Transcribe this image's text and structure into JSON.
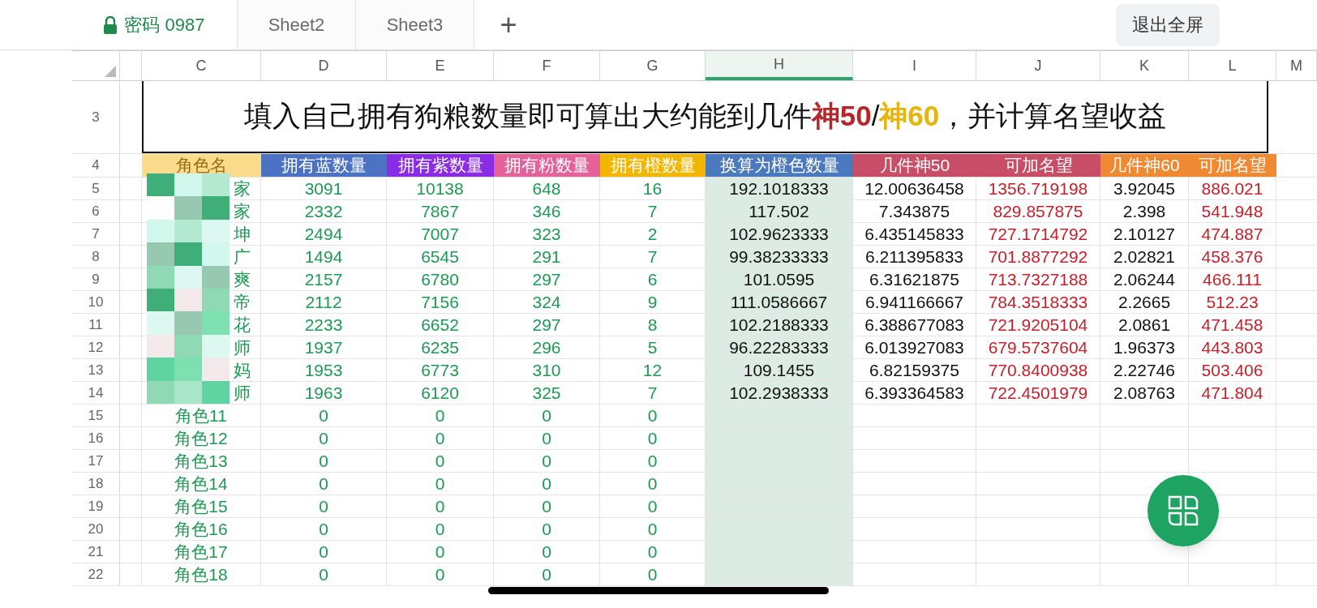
{
  "sheet_tabs": [
    {
      "label": "密码 0987",
      "locked": true,
      "selected": true
    },
    {
      "label": "Sheet2",
      "locked": false,
      "selected": false
    },
    {
      "label": "Sheet3",
      "locked": false,
      "selected": false
    }
  ],
  "add_sheet": "+",
  "exit_button": "退出全屏",
  "column_letters": [
    {
      "letter": "C",
      "selected": false
    },
    {
      "letter": "D",
      "selected": false
    },
    {
      "letter": "E",
      "selected": false
    },
    {
      "letter": "F",
      "selected": false
    },
    {
      "letter": "G",
      "selected": false
    },
    {
      "letter": "H",
      "selected": true
    },
    {
      "letter": "I",
      "selected": false
    },
    {
      "letter": "J",
      "selected": false
    },
    {
      "letter": "K",
      "selected": false
    },
    {
      "letter": "L",
      "selected": false
    },
    {
      "letter": "M",
      "selected": false
    }
  ],
  "title_row": {
    "number": "3",
    "parts": [
      {
        "text": "填入自己拥有狗粮数量即可算出大约能到几件"
      },
      {
        "text": "神50",
        "color": "#b8262c"
      },
      {
        "text": "/"
      },
      {
        "text": "神60",
        "color": "#e6b40a"
      },
      {
        "text": "，并计算名望收益"
      }
    ]
  },
  "header_row": {
    "number": "4",
    "headers": [
      {
        "text": "角色名",
        "color": "#fbdc8c",
        "kind": "name"
      },
      {
        "text": "拥有蓝数量",
        "color": "#4c72c4",
        "kind": "count"
      },
      {
        "text": "拥有紫数量",
        "color": "#8a2be6",
        "kind": "count"
      },
      {
        "text": "拥有粉数量",
        "color": "#e4619a",
        "kind": "count"
      },
      {
        "text": "拥有橙数量",
        "color": "#f3b600",
        "kind": "count"
      },
      {
        "text": "换算为橙色数量",
        "color": "#4b79bd",
        "kind": "plain"
      },
      {
        "text": "几件神50",
        "color": "#c84d67",
        "kind": "plain"
      },
      {
        "text": "可加名望",
        "color": "#c84d67",
        "kind": "fame"
      },
      {
        "text": "几件神60",
        "color": "#ef8a33",
        "kind": "plain"
      },
      {
        "text": "可加名望",
        "color": "#ef8a33",
        "kind": "fame"
      }
    ]
  },
  "rows": [
    {
      "number": "5",
      "cells": [
        "家",
        "3091",
        "10138",
        "648",
        "16",
        "192.1018333",
        "12.00636458",
        "1356.719198",
        "3.92045",
        "886.021"
      ]
    },
    {
      "number": "6",
      "cells": [
        "家",
        "2332",
        "7867",
        "346",
        "7",
        "117.502",
        "7.343875",
        "829.857875",
        "2.398",
        "541.948"
      ]
    },
    {
      "number": "7",
      "cells": [
        "坤",
        "2494",
        "7007",
        "323",
        "2",
        "102.9623333",
        "6.435145833",
        "727.1714792",
        "2.10127",
        "474.887"
      ]
    },
    {
      "number": "8",
      "cells": [
        "广",
        "1494",
        "6545",
        "291",
        "7",
        "99.38233333",
        "6.211395833",
        "701.8877292",
        "2.02821",
        "458.376"
      ]
    },
    {
      "number": "9",
      "cells": [
        "爽",
        "2157",
        "6780",
        "297",
        "6",
        "101.0595",
        "6.31621875",
        "713.7327188",
        "2.06244",
        "466.111"
      ]
    },
    {
      "number": "10",
      "cells": [
        "帝",
        "2112",
        "7156",
        "324",
        "9",
        "111.0586667",
        "6.941166667",
        "784.3518333",
        "2.2665",
        "512.23"
      ]
    },
    {
      "number": "11",
      "cells": [
        "花",
        "2233",
        "6652",
        "297",
        "8",
        "102.2188333",
        "6.388677083",
        "721.9205104",
        "2.0861",
        "471.458"
      ]
    },
    {
      "number": "12",
      "cells": [
        "师",
        "1937",
        "6235",
        "296",
        "5",
        "96.22283333",
        "6.013927083",
        "679.5737604",
        "1.96373",
        "443.803"
      ]
    },
    {
      "number": "13",
      "cells": [
        "妈",
        "1953",
        "6773",
        "310",
        "12",
        "109.1455",
        "6.82159375",
        "770.8400938",
        "2.22746",
        "503.406"
      ]
    },
    {
      "number": "14",
      "cells": [
        "师",
        "1963",
        "6120",
        "325",
        "7",
        "102.2938333",
        "6.393364583",
        "722.4501979",
        "2.08763",
        "471.804"
      ]
    },
    {
      "number": "15",
      "cells": [
        "角色11",
        "0",
        "0",
        "0",
        "0"
      ]
    },
    {
      "number": "16",
      "cells": [
        "角色12",
        "0",
        "0",
        "0",
        "0"
      ]
    },
    {
      "number": "17",
      "cells": [
        "角色13",
        "0",
        "0",
        "0",
        "0"
      ]
    },
    {
      "number": "18",
      "cells": [
        "角色14",
        "0",
        "0",
        "0",
        "0"
      ]
    },
    {
      "number": "19",
      "cells": [
        "角色15",
        "0",
        "0",
        "0",
        "0"
      ]
    },
    {
      "number": "20",
      "cells": [
        "角色16",
        "0",
        "0",
        "0",
        "0"
      ]
    },
    {
      "number": "21",
      "cells": [
        "角色17",
        "0",
        "0",
        "0",
        "0"
      ]
    },
    {
      "number": "22",
      "cells": [
        "角色18",
        "0",
        "0",
        "0",
        "0"
      ]
    }
  ]
}
